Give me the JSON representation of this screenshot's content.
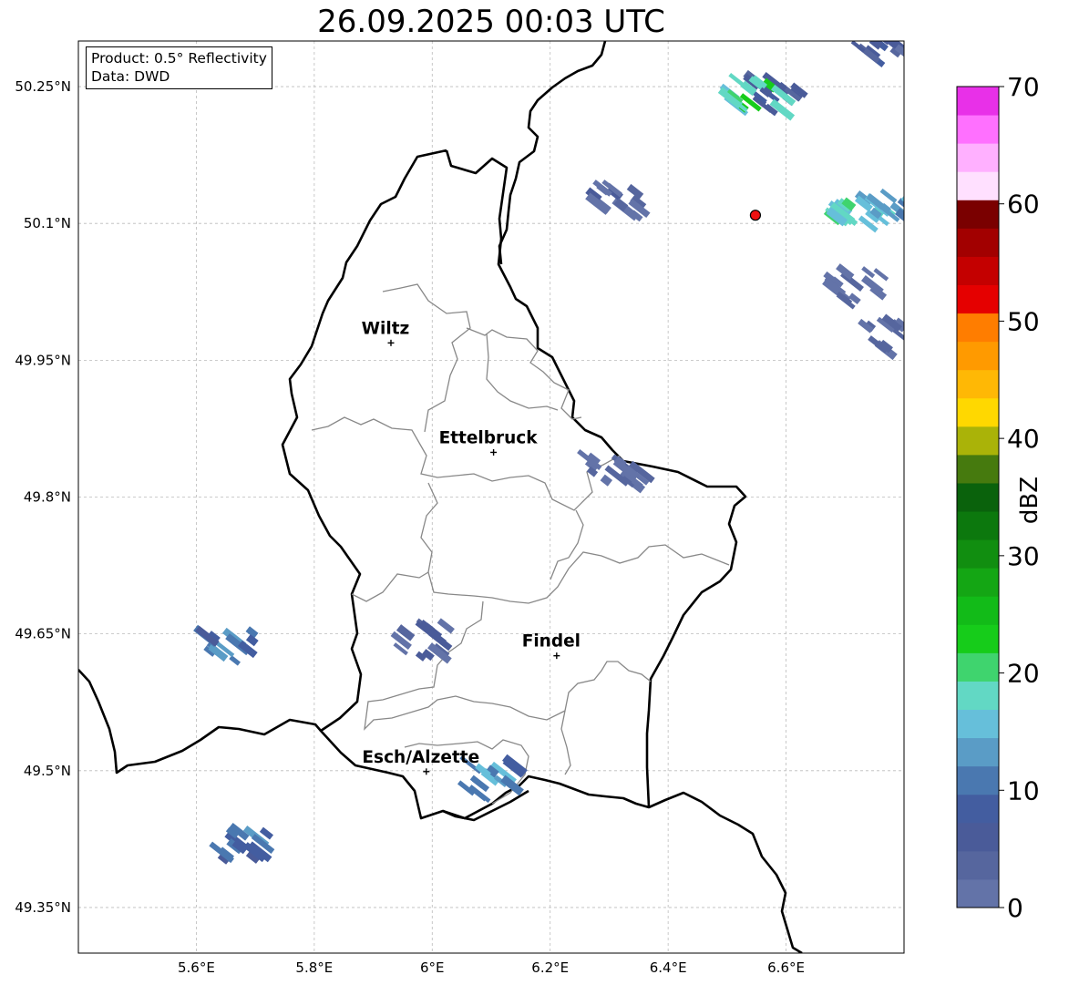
{
  "title": "26.09.2025 00:03 UTC",
  "info": {
    "product": "Product: 0.5° Reflectivity",
    "data": "Data: DWD"
  },
  "map": {
    "extent": {
      "lon": [
        5.4,
        6.8
      ],
      "lat": [
        49.3,
        50.3
      ]
    },
    "lon_ticks": [
      {
        "value": 5.6,
        "label": "5.6°E"
      },
      {
        "value": 5.8,
        "label": "5.8°E"
      },
      {
        "value": 6.0,
        "label": "6°E"
      },
      {
        "value": 6.2,
        "label": "6.2°E"
      },
      {
        "value": 6.4,
        "label": "6.4°E"
      },
      {
        "value": 6.6,
        "label": "6.6°E"
      }
    ],
    "lat_ticks": [
      {
        "value": 50.25,
        "label": "50.25°N"
      },
      {
        "value": 50.1,
        "label": "50.1°N"
      },
      {
        "value": 49.95,
        "label": "49.95°N"
      },
      {
        "value": 49.8,
        "label": "49.8°N"
      },
      {
        "value": 49.65,
        "label": "49.65°N"
      },
      {
        "value": 49.5,
        "label": "49.5°N"
      },
      {
        "value": 49.35,
        "label": "49.35°N"
      }
    ],
    "grid": true,
    "cities": [
      {
        "name": "Wiltz",
        "lon": 5.93,
        "lat": 49.969
      },
      {
        "name": "Ettelbruck",
        "lon": 6.104,
        "lat": 49.849
      },
      {
        "name": "Findel",
        "lon": 6.211,
        "lat": 49.626
      },
      {
        "name": "Esch/Alzette",
        "lon": 5.99,
        "lat": 49.499
      }
    ],
    "radar_site": {
      "lon": 6.548,
      "lat": 50.109,
      "color": "#ee1111"
    },
    "echoes": [
      {
        "lon": 6.58,
        "lat": 50.24,
        "dbz": 8
      },
      {
        "lon": 6.55,
        "lat": 50.239,
        "dbz": 22
      },
      {
        "lon": 6.75,
        "lat": 50.295,
        "dbz": 6
      },
      {
        "lon": 6.72,
        "lat": 50.115,
        "dbz": 20
      },
      {
        "lon": 6.77,
        "lat": 50.115,
        "dbz": 16
      },
      {
        "lon": 6.72,
        "lat": 50.03,
        "dbz": 4
      },
      {
        "lon": 6.78,
        "lat": 49.975,
        "dbz": 4
      },
      {
        "lon": 6.32,
        "lat": 50.125,
        "dbz": 5
      },
      {
        "lon": 5.65,
        "lat": 49.635,
        "dbz": 12
      },
      {
        "lon": 5.68,
        "lat": 49.42,
        "dbz": 12
      },
      {
        "lon": 6.1,
        "lat": 49.49,
        "dbz": 14
      },
      {
        "lon": 5.98,
        "lat": 49.642,
        "dbz": 6
      },
      {
        "lon": 6.31,
        "lat": 49.825,
        "dbz": 4
      }
    ]
  },
  "colorbar": {
    "label": "dBZ",
    "min": 0,
    "max": 70,
    "ticks": [
      {
        "value": 0,
        "label": "0"
      },
      {
        "value": 10,
        "label": "10"
      },
      {
        "value": 20,
        "label": "20"
      },
      {
        "value": 30,
        "label": "30"
      },
      {
        "value": 40,
        "label": "40"
      },
      {
        "value": 50,
        "label": "50"
      },
      {
        "value": 60,
        "label": "60"
      },
      {
        "value": 70,
        "label": "70"
      }
    ],
    "colors": [
      "#6373a8",
      "#56669e",
      "#4a5b99",
      "#435da0",
      "#4a78b0",
      "#5a9cc6",
      "#66bfda",
      "#62d8c4",
      "#3fd46e",
      "#16cc1a",
      "#12bb18",
      "#14a614",
      "#118e10",
      "#0c780d",
      "#0a620c",
      "#467a0e",
      "#aab308",
      "#ffd800",
      "#ffb805",
      "#ff9a00",
      "#ff7d00",
      "#e50000",
      "#c40000",
      "#a20000",
      "#7a0000",
      "#ffe0ff",
      "#ffb0ff",
      "#ff70ff",
      "#e830e8"
    ]
  }
}
